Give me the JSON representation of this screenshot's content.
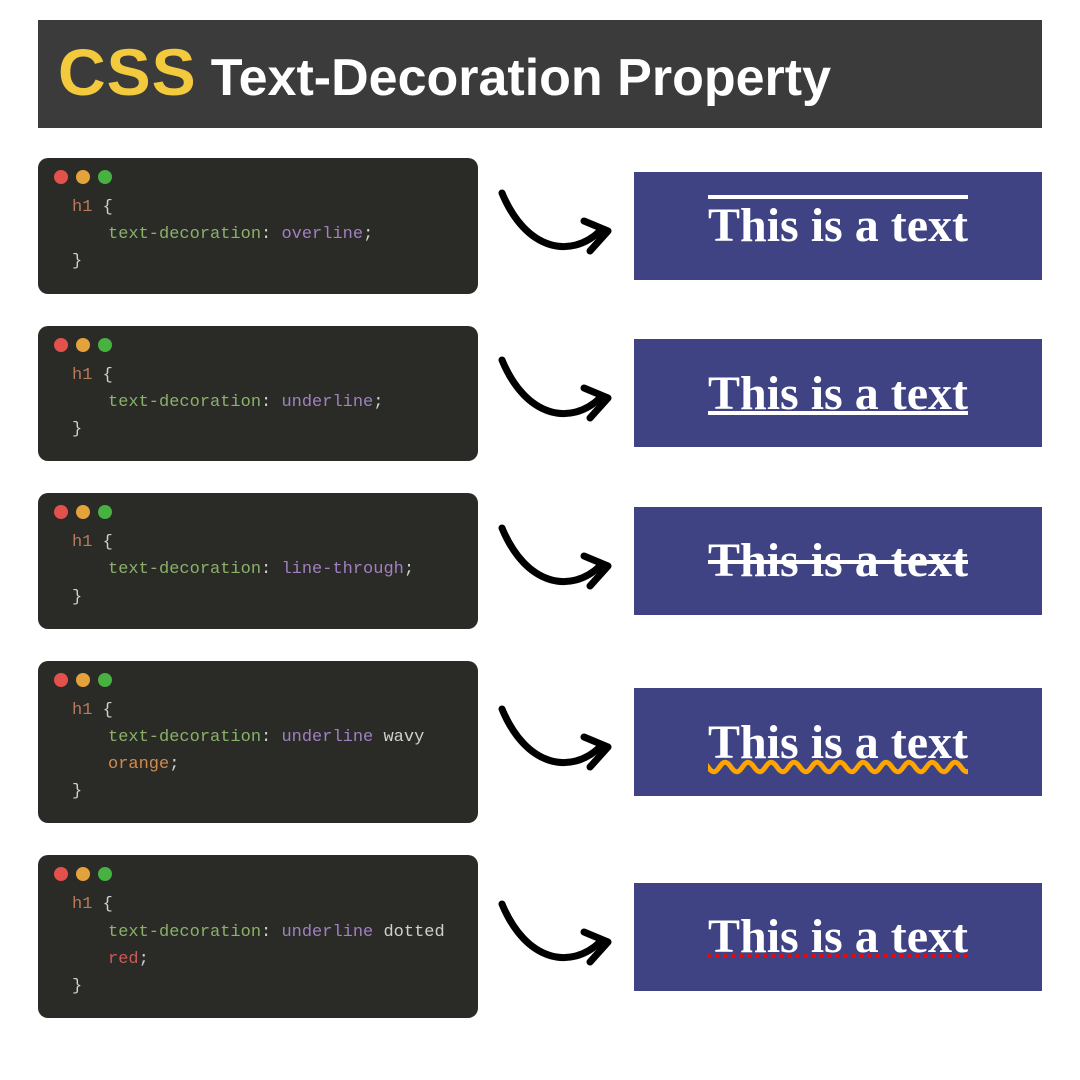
{
  "title": {
    "css": "CSS",
    "rest": "Text-Decoration Property"
  },
  "code": {
    "selector": "h1",
    "property": "text-decoration",
    "brace_open": "{",
    "brace_close": "}",
    "colon": ":",
    "semicolon": ";"
  },
  "examples": [
    {
      "value_tokens": [
        {
          "text": "overline",
          "cls": "c-val"
        }
      ],
      "output_text": "This is a text",
      "deco_class": "deco-overline"
    },
    {
      "value_tokens": [
        {
          "text": "underline",
          "cls": "c-val"
        }
      ],
      "output_text": "This is a text",
      "deco_class": "deco-underline"
    },
    {
      "value_tokens": [
        {
          "text": "line-through",
          "cls": "c-val"
        }
      ],
      "output_text": "This is a text",
      "deco_class": "deco-through"
    },
    {
      "value_tokens": [
        {
          "text": "underline",
          "cls": "c-kw"
        },
        {
          "text": "wavy",
          "cls": "c-wavy"
        },
        {
          "text": "orange",
          "cls": "c-orange"
        }
      ],
      "output_text": "This is a text",
      "deco_class": "deco-wavy"
    },
    {
      "value_tokens": [
        {
          "text": "underline",
          "cls": "c-kw"
        },
        {
          "text": "dotted",
          "cls": "c-wavy"
        },
        {
          "text": "red",
          "cls": "c-red"
        }
      ],
      "output_text": "This is a text",
      "deco_class": "deco-dotted"
    }
  ]
}
